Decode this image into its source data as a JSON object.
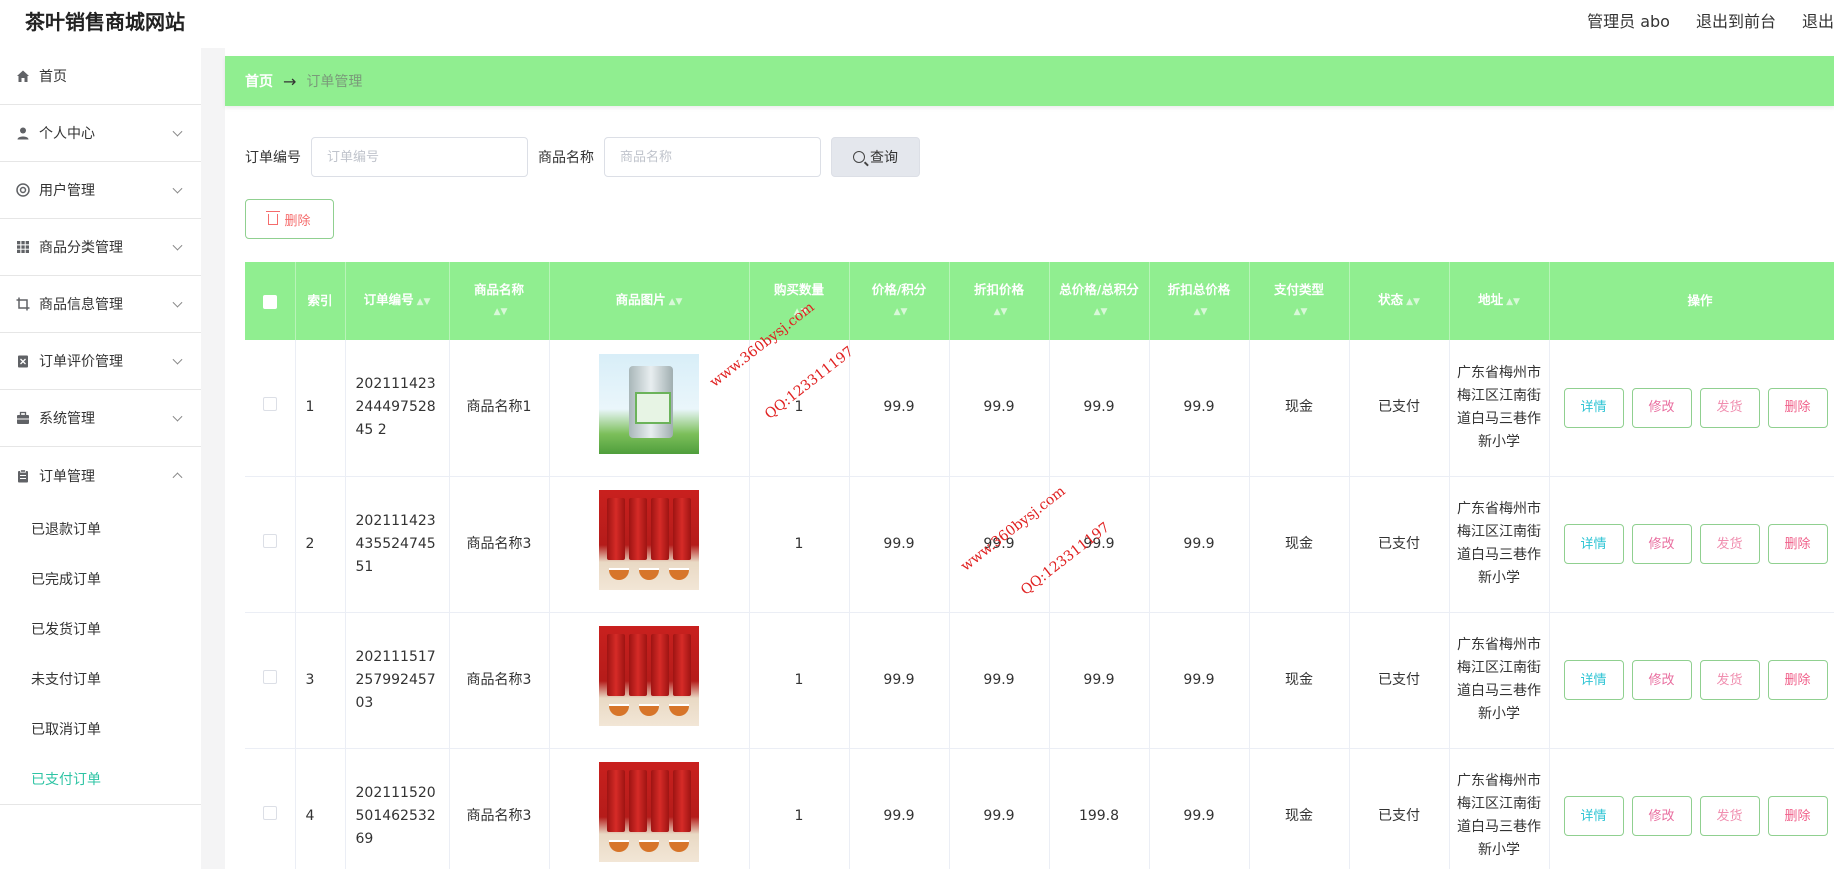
{
  "header": {
    "site_title": "茶叶销售商城网站",
    "admin_label": "管理员 abo",
    "exit_front_label": "退出到前台",
    "logout_label": "退出"
  },
  "sidebar": {
    "items": [
      {
        "label": "首页",
        "icon": "home-icon"
      },
      {
        "label": "个人中心",
        "icon": "user-icon"
      },
      {
        "label": "用户管理",
        "icon": "users-circle-icon"
      },
      {
        "label": "商品分类管理",
        "icon": "grid-icon"
      },
      {
        "label": "商品信息管理",
        "icon": "crop-icon"
      },
      {
        "label": "订单评价管理",
        "icon": "evaluate-icon"
      },
      {
        "label": "系统管理",
        "icon": "briefcase-icon"
      },
      {
        "label": "订单管理",
        "icon": "clipboard-icon"
      }
    ],
    "sub_items": [
      {
        "label": "已退款订单"
      },
      {
        "label": "已完成订单"
      },
      {
        "label": "已发货订单"
      },
      {
        "label": "未支付订单"
      },
      {
        "label": "已取消订单"
      },
      {
        "label": "已支付订单",
        "active": true
      }
    ],
    "active_color": "#2ec4a4"
  },
  "breadcrumb": {
    "home": "首页",
    "arrow": "→",
    "current": "订单管理"
  },
  "search": {
    "order_no_label": "订单编号",
    "order_no_placeholder": "订单编号",
    "order_no_value": "",
    "product_name_label": "商品名称",
    "product_name_placeholder": "商品名称",
    "product_name_value": "",
    "query_label": "查询"
  },
  "toolbar": {
    "delete_label": "删除"
  },
  "table": {
    "headers": {
      "index": "索引",
      "order_no": "订单编号",
      "product_name": "商品名称",
      "product_image": "商品图片",
      "quantity": "购买数量",
      "price": "价格/积分",
      "discount_price": "折扣价格",
      "total": "总价格/总积分",
      "discount_total": "折扣总价格",
      "pay_type": "支付类型",
      "status": "状态",
      "address": "地址",
      "actions": "操作"
    },
    "rows": [
      {
        "index": "1",
        "order_no": "20211142324449752845 2",
        "product_name": "商品名称1",
        "image": "green-tea-can",
        "quantity": "1",
        "price": "99.9",
        "discount_price": "99.9",
        "total": "99.9",
        "discount_total": "99.9",
        "pay_type": "现金",
        "status": "已支付",
        "address": "广东省梅州市梅江区江南街道白马三巷作新小学"
      },
      {
        "index": "2",
        "order_no": "20211142343552474551",
        "product_name": "商品名称3",
        "image": "red-tea-cans",
        "quantity": "1",
        "price": "99.9",
        "discount_price": "99.9",
        "total": "99.9",
        "discount_total": "99.9",
        "pay_type": "现金",
        "status": "已支付",
        "address": "广东省梅州市梅江区江南街道白马三巷作新小学"
      },
      {
        "index": "3",
        "order_no": "20211151725799245703",
        "product_name": "商品名称3",
        "image": "red-tea-cans",
        "quantity": "1",
        "price": "99.9",
        "discount_price": "99.9",
        "total": "99.9",
        "discount_total": "99.9",
        "pay_type": "现金",
        "status": "已支付",
        "address": "广东省梅州市梅江区江南街道白马三巷作新小学"
      },
      {
        "index": "4",
        "order_no": "20211152050146253269",
        "product_name": "商品名称3",
        "image": "red-tea-cans",
        "quantity": "1",
        "price": "99.9",
        "discount_price": "99.9",
        "total": "199.8",
        "discount_total": "99.9",
        "pay_type": "现金",
        "status": "已支付",
        "address": "广东省梅州市梅江区江南街道白马三巷作新小学"
      }
    ],
    "action_labels": {
      "detail": "详情",
      "edit": "修改",
      "ship": "发货",
      "delete": "删除"
    }
  },
  "watermarks": [
    {
      "line1": "www.360bysj.com",
      "line2": "QQ:123311197"
    },
    {
      "line1": "www.360bysj.com",
      "line2": "QQ:123311197"
    }
  ],
  "colors": {
    "accent_green": "#90ee90",
    "query_bg": "#e4e7ed",
    "danger": "#f56c6c"
  }
}
